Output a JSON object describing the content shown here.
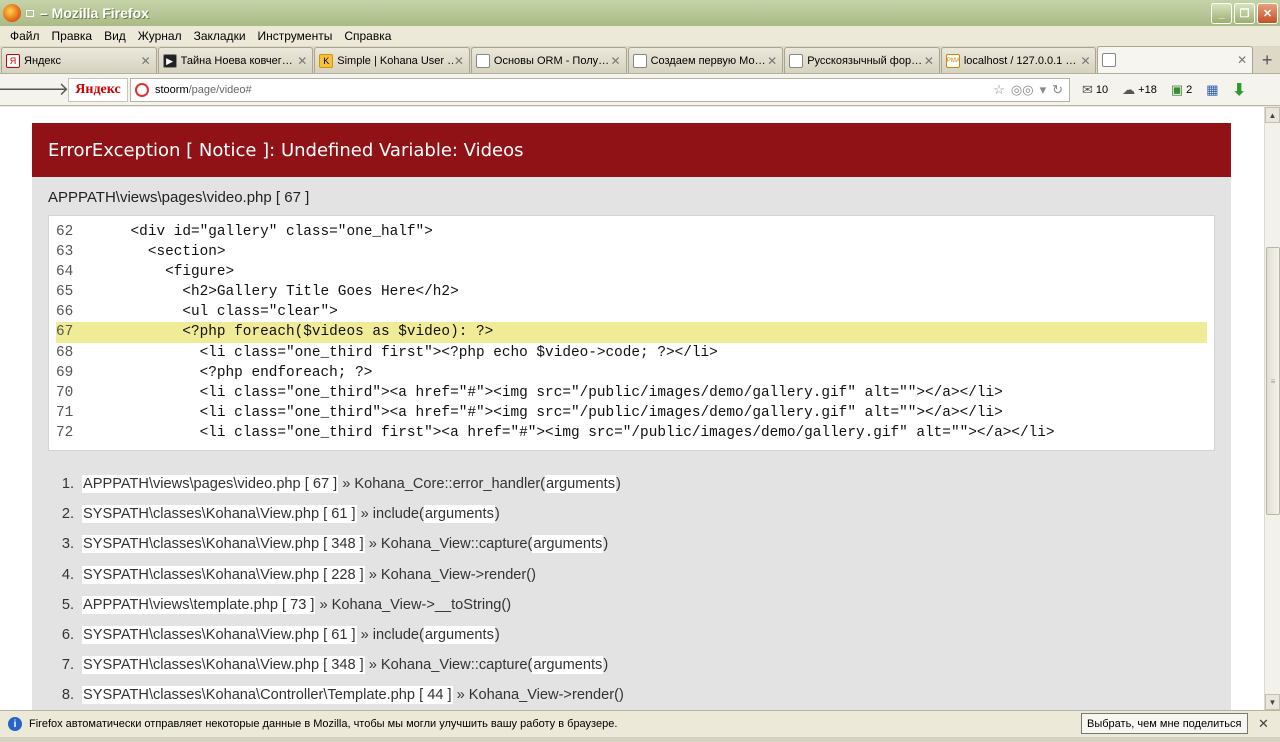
{
  "window": {
    "title": "– Mozilla Firefox"
  },
  "menu": [
    "Файл",
    "Правка",
    "Вид",
    "Журнал",
    "Закладки",
    "Инструменты",
    "Справка"
  ],
  "tabs": [
    {
      "label": "Яндекс",
      "icon": "Я",
      "active": false
    },
    {
      "label": "Тайна Ноева ковчег…",
      "icon": "▶",
      "active": false
    },
    {
      "label": "Simple | Kohana User …",
      "icon": "K",
      "active": false
    },
    {
      "label": "Основы ORM - Полу…",
      "icon": "",
      "active": false
    },
    {
      "label": "Создаем первую Мо…",
      "icon": "",
      "active": false
    },
    {
      "label": "Русскоязычный фор…",
      "icon": "",
      "active": false
    },
    {
      "label": "localhost / 127.0.0.1 …",
      "icon": "PMA",
      "active": false
    },
    {
      "label": "",
      "icon": "",
      "active": true
    }
  ],
  "nav": {
    "yandex_label": "Яндекс",
    "url_host": "stoorm",
    "url_path": "/page/video#",
    "mail_count": "10",
    "weather": "+18",
    "counter": "2"
  },
  "error": {
    "title": "ErrorException [ Notice ]: Undefined Variable: Videos",
    "file": "APPPATH\\views\\pages\\video.php [ 67 ]",
    "highlight_line": "67",
    "code": [
      {
        "n": "62",
        "text": "    <div id=\"gallery\" class=\"one_half\">"
      },
      {
        "n": "63",
        "text": "      <section>"
      },
      {
        "n": "64",
        "text": "        <figure>"
      },
      {
        "n": "65",
        "text": "          <h2>Gallery Title Goes Here</h2>"
      },
      {
        "n": "66",
        "text": "          <ul class=\"clear\">"
      },
      {
        "n": "67",
        "text": "          <?php foreach($videos as $video): ?>"
      },
      {
        "n": "68",
        "text": "            <li class=\"one_third first\"><?php echo $video->code; ?></li>"
      },
      {
        "n": "69",
        "text": "            <?php endforeach; ?>"
      },
      {
        "n": "70",
        "text": "            <li class=\"one_third\"><a href=\"#\"><img src=\"/public/images/demo/gallery.gif\" alt=\"\"></a></li>"
      },
      {
        "n": "71",
        "text": "            <li class=\"one_third\"><a href=\"#\"><img src=\"/public/images/demo/gallery.gif\" alt=\"\"></a></li>"
      },
      {
        "n": "72",
        "text": "            <li class=\"one_third first\"><a href=\"#\"><img src=\"/public/images/demo/gallery.gif\" alt=\"\"></a></li>"
      }
    ],
    "trace": [
      {
        "num": "1.",
        "file": "APPPATH\\views\\pages\\video.php [ 67 ]",
        "call": " » Kohana_Core::error_handler(",
        "args": "arguments",
        "end": ")"
      },
      {
        "num": "2.",
        "file": "SYSPATH\\classes\\Kohana\\View.php [ 61 ]",
        "call": " » include(",
        "args": "arguments",
        "end": ")"
      },
      {
        "num": "3.",
        "file": "SYSPATH\\classes\\Kohana\\View.php [ 348 ]",
        "call": " » Kohana_View::capture(",
        "args": "arguments",
        "end": ")"
      },
      {
        "num": "4.",
        "file": "SYSPATH\\classes\\Kohana\\View.php [ 228 ]",
        "call": " » Kohana_View->render()",
        "args": "",
        "end": ""
      },
      {
        "num": "5.",
        "file": "APPPATH\\views\\template.php [ 73 ]",
        "call": " » Kohana_View->__toString()",
        "args": "",
        "end": ""
      },
      {
        "num": "6.",
        "file": "SYSPATH\\classes\\Kohana\\View.php [ 61 ]",
        "call": " » include(",
        "args": "arguments",
        "end": ")"
      },
      {
        "num": "7.",
        "file": "SYSPATH\\classes\\Kohana\\View.php [ 348 ]",
        "call": " » Kohana_View::capture(",
        "args": "arguments",
        "end": ")"
      },
      {
        "num": "8.",
        "file": "SYSPATH\\classes\\Kohana\\Controller\\Template.php [ 44 ]",
        "call": " » Kohana_View->render()",
        "args": "",
        "end": ""
      }
    ]
  },
  "notification": {
    "text": "Firefox автоматически отправляет некоторые данные в Mozilla, чтобы мы могли улучшить вашу работу в браузере.",
    "button": "Выбрать, чем мне поделиться"
  },
  "colors": {
    "error_header": "#911216",
    "highlight": "#f0eb96",
    "titlebar": "#a9bb86"
  }
}
